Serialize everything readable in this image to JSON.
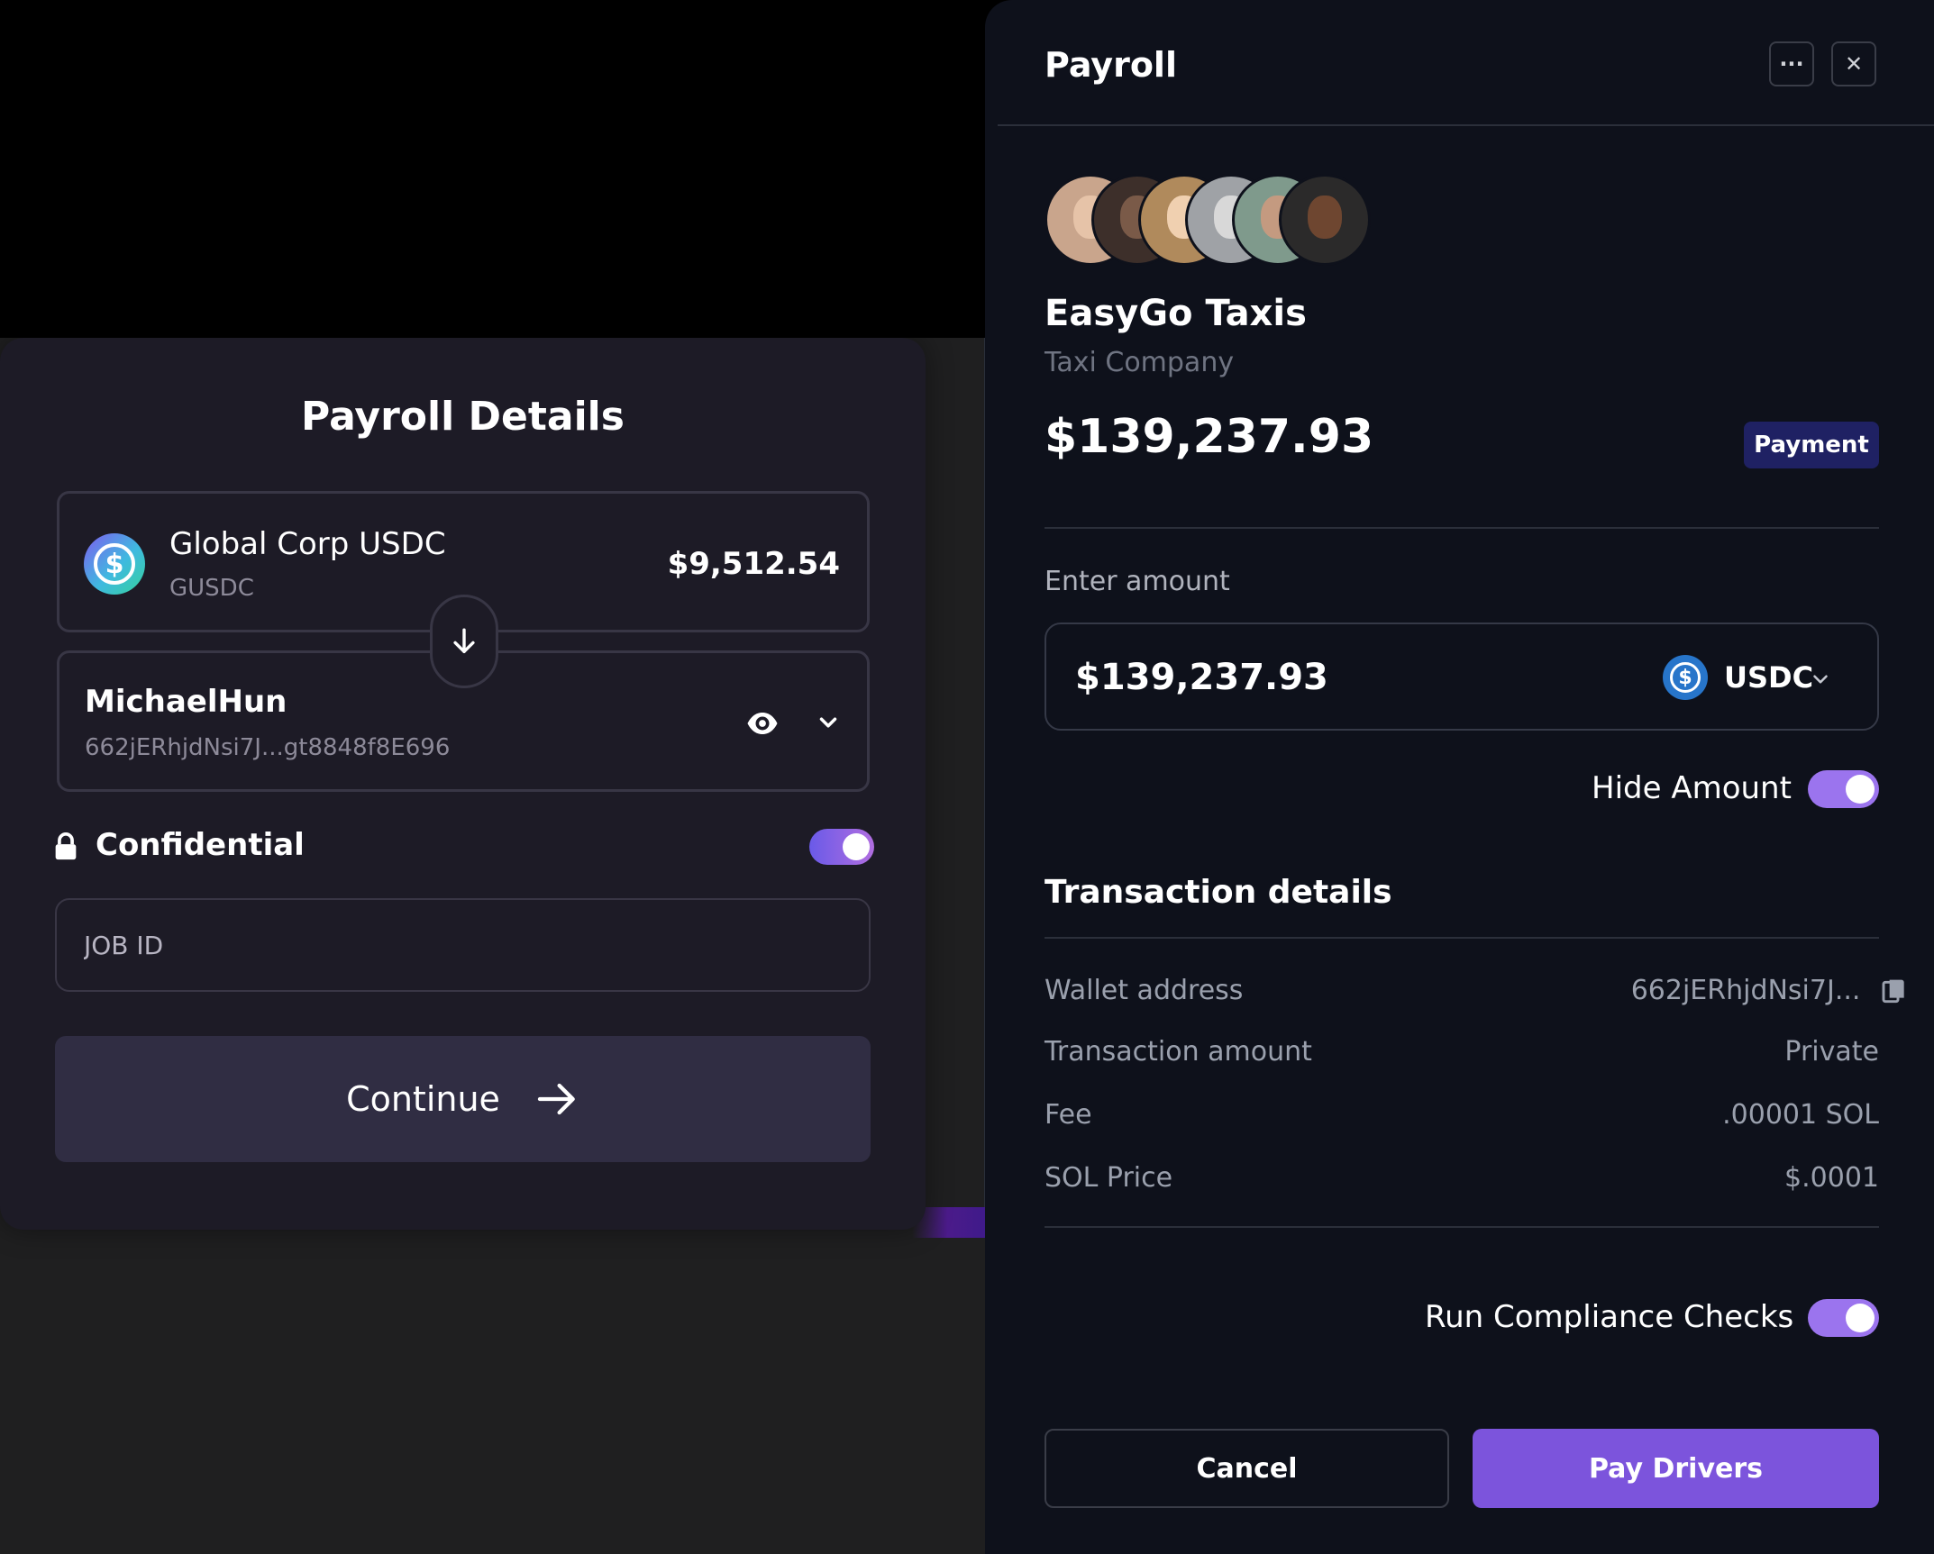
{
  "left_card": {
    "title": "Payroll Details",
    "from_token": {
      "name": "Global Corp USDC",
      "symbol": "GUSDC",
      "balance": "$9,512.54",
      "icon": "usdc-icon"
    },
    "recipient": {
      "name": "MichaelHun",
      "address": "662jERhjdNsi7J...gt8848f8E696"
    },
    "confidential": {
      "label": "Confidential",
      "enabled": true
    },
    "job_id": {
      "placeholder": "JOB ID",
      "value": ""
    },
    "continue_label": "Continue"
  },
  "right_panel": {
    "title": "Payroll",
    "company": {
      "name": "EasyGo Taxis",
      "subtitle": "Taxi Company",
      "avatars": 6
    },
    "total_amount": "$139,237.93",
    "badge": "Payment",
    "enter_amount": {
      "label": "Enter amount",
      "value": "$139,237.93",
      "currency": "USDC"
    },
    "hide_amount": {
      "label": "Hide Amount",
      "enabled": true
    },
    "transaction_details": {
      "title": "Transaction details",
      "rows": [
        {
          "label": "Wallet address",
          "value": "662jERhjdNsi7J..."
        },
        {
          "label": "Transaction amount",
          "value": "Private"
        },
        {
          "label": "Fee",
          "value": ".00001 SOL"
        },
        {
          "label": "SOL Price",
          "value": "$.0001"
        }
      ]
    },
    "compliance": {
      "label": "Run Compliance Checks",
      "enabled": true
    },
    "cancel_label": "Cancel",
    "pay_label": "Pay Drivers"
  },
  "colors": {
    "accent": "#7c54dc",
    "panel_bg": "#0e111b",
    "card_bg": "#1d1b26"
  }
}
